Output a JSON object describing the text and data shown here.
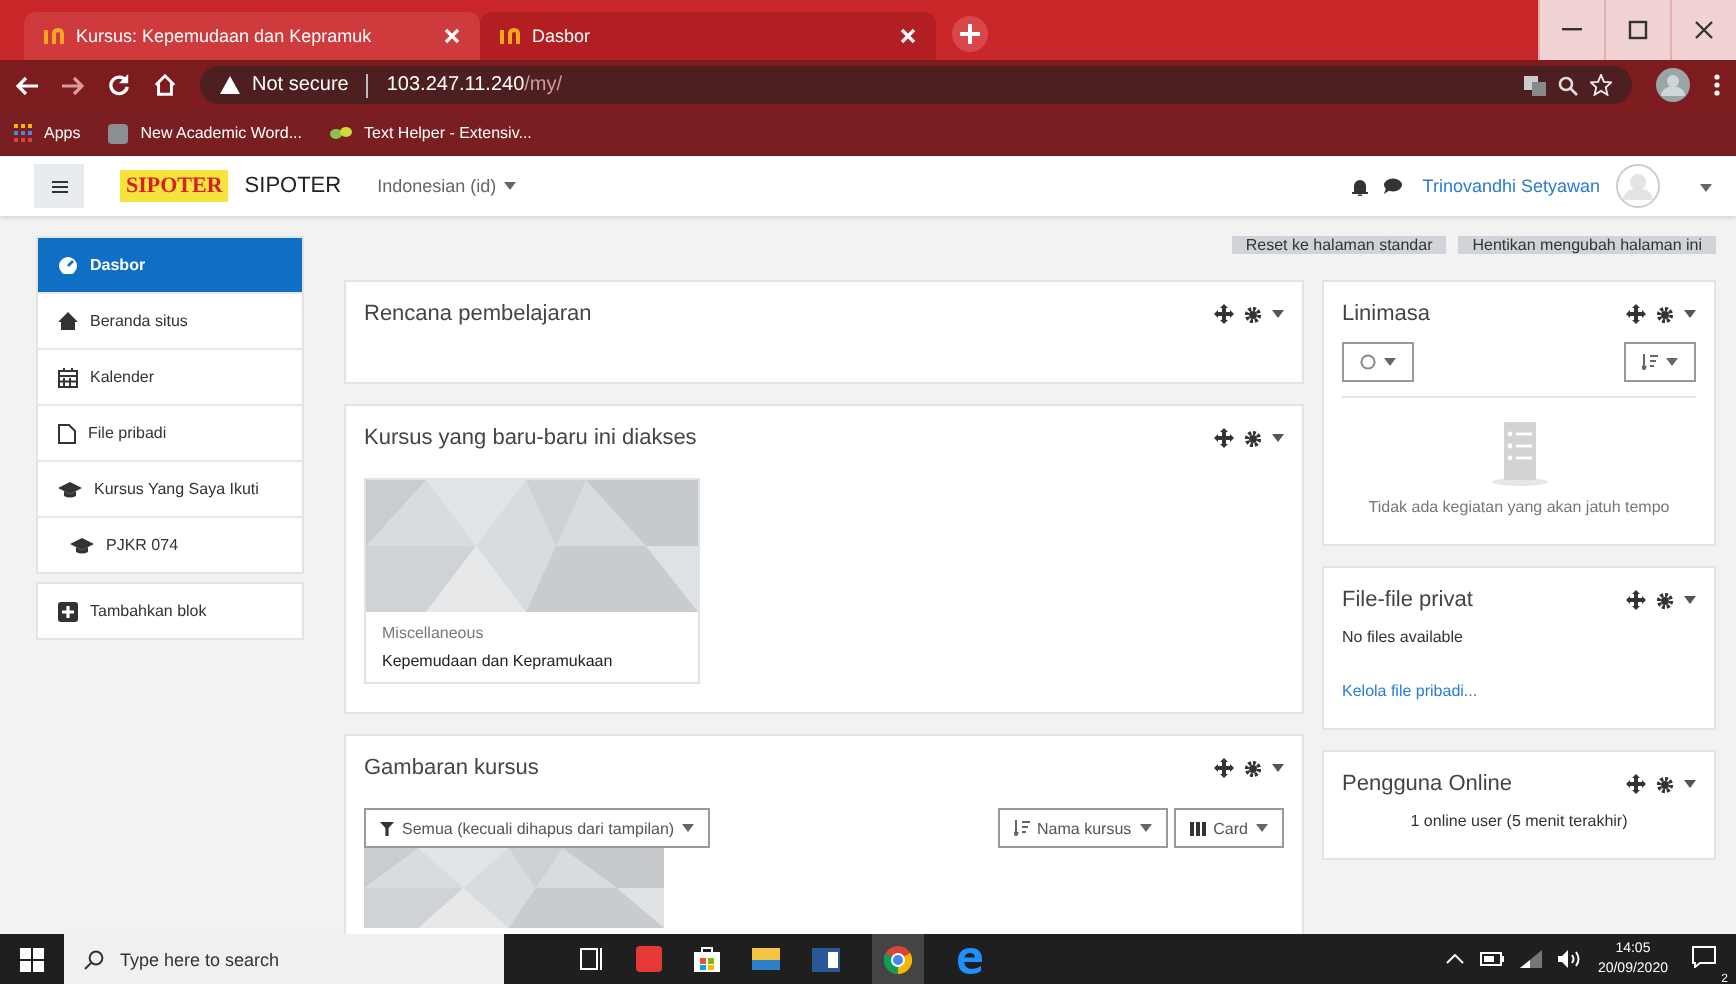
{
  "browser": {
    "tabs": [
      {
        "title": "Kursus: Kepemudaan dan Kepramuk",
        "selected": false
      },
      {
        "title": "Dasbor",
        "selected": true
      }
    ],
    "address": {
      "security": "Not secure",
      "host": "103.247.11.240",
      "path": "/my/"
    },
    "bookmarks": [
      "Apps",
      "New Academic Word...",
      "Text Helper - Extensiv..."
    ]
  },
  "header": {
    "logo": "SIPOTER",
    "site_name": "SIPOTER",
    "language": "Indonesian (id)",
    "user": "Trinovandhi Setyawan"
  },
  "sidebar": {
    "items": [
      {
        "label": "Dasbor",
        "selected": true
      },
      {
        "label": "Beranda situs",
        "selected": false
      },
      {
        "label": "Kalender",
        "selected": false
      },
      {
        "label": "File pribadi",
        "selected": false
      },
      {
        "label": "Kursus Yang Saya Ikuti",
        "selected": false
      },
      {
        "label": "PJKR 074",
        "selected": false
      }
    ],
    "add_block": "Tambahkan blok"
  },
  "page_buttons": [
    "Reset ke halaman standar",
    "Hentikan mengubah halaman ini"
  ],
  "main_blocks": [
    {
      "kind": "plain",
      "title": "Rencana pembelajaran"
    },
    {
      "kind": "recent",
      "title": "Kursus yang baru-baru ini diakses",
      "course": {
        "category": "Miscellaneous",
        "name": "Kepemudaan dan Kepramukaan"
      }
    },
    {
      "kind": "overview",
      "title": "Gambaran kursus",
      "filter": "Semua (kecuali dihapus dari tampilan)",
      "sort": "Nama kursus",
      "view": "Card"
    }
  ],
  "side_blocks": [
    {
      "kind": "timeline",
      "title": "Linimasa",
      "empty": "Tidak ada kegiatan yang akan jatuh tempo"
    },
    {
      "kind": "files",
      "title": "File-file privat",
      "empty": "No files available",
      "link": "Kelola file pribadi..."
    },
    {
      "kind": "online",
      "title": "Pengguna Online",
      "summary": "1 online user (5 menit terakhir)"
    }
  ],
  "taskbar": {
    "search": "Type here to search",
    "time": "14:05",
    "date": "20/09/2020",
    "notifications": "2"
  }
}
